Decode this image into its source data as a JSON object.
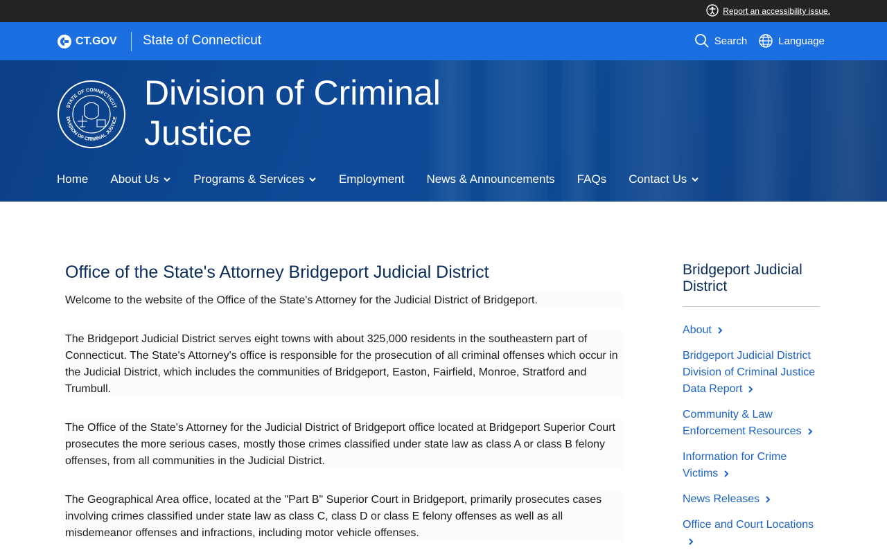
{
  "topbar": {
    "a11y_label": "Report an accessibility issue."
  },
  "ctbar": {
    "logo_text": "CT.GOV",
    "state_label": "State of Connecticut",
    "search_label": "Search",
    "language_label": "Language"
  },
  "hero": {
    "title_line1": "Division of Criminal",
    "title_line2": "Justice",
    "seal_text_top": "STATE OF CONNECTICUT",
    "seal_text_bottom": "DIVISION OF CRIMINAL JUSTICE"
  },
  "nav": {
    "home": "Home",
    "about": "About Us",
    "programs": "Programs & Services",
    "employment": "Employment",
    "news": "News & Announcements",
    "faqs": "FAQs",
    "contact": "Contact Us"
  },
  "main": {
    "heading": "Office of the State's Attorney Bridgeport Judicial District",
    "paragraphs": [
      "Welcome to the website of the Office of the State's Attorney for the Judicial District of Bridgeport.",
      "The Bridgeport Judicial District serves eight towns with about 325,000 residents in the southeastern part of Connecticut. The State's Attorney's office is responsible for the prosecution of all criminal offenses which occur in the Judicial District, which includes the communities of Bridgeport, Easton, Fairfield, Monroe, Stratford and Trumbull.",
      "The Office of the State's Attorney for the Judicial District of Bridgeport office located at Bridgeport Superior Court prosecutes the more serious cases, mostly those crimes classified under state law as class A or class B felony offenses, from all communities in the Judicial District.",
      "The Geographical Area office, located at the \"Part B\" Superior Court in Bridgeport, primarily prosecutes cases involving crimes classified under state law as class C, class D or class E felony offenses as well as all misdemeanor offenses and infractions, including motor vehicle offenses."
    ]
  },
  "sidebar": {
    "title": "Bridgeport Judicial District",
    "links": [
      "About",
      "Bridgeport Judicial District Division of Criminal Justice Data Report",
      "Community & Law Enforcement Resources",
      "Information for Crime Victims",
      "News Releases",
      "Office and Court Locations"
    ]
  }
}
